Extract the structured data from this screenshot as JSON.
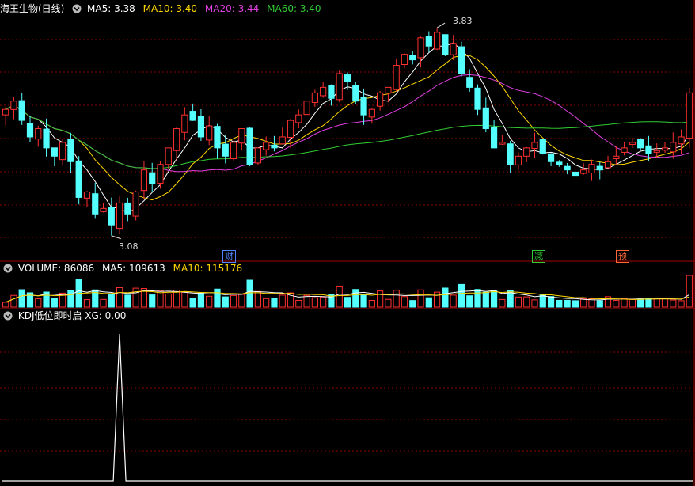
{
  "main_panel": {
    "title": "海王生物(日线)",
    "ma_items": [
      {
        "label": "MA5: 3.38",
        "color": "#ffffff"
      },
      {
        "label": "MA10: 3.40",
        "color": "#ffd700"
      },
      {
        "label": "MA20: 3.44",
        "color": "#e040e0"
      },
      {
        "label": "MA60: 3.40",
        "color": "#33cc33"
      }
    ],
    "high_label": "3.83",
    "low_label": "3.08",
    "event_tags": [
      {
        "text": "财",
        "color": "#4f86ff"
      },
      {
        "text": "减",
        "color": "#33cc33"
      },
      {
        "text": "预",
        "color": "#ff6633"
      }
    ]
  },
  "volume_panel": {
    "label": "VOLUME: 86086",
    "ma5_label": "MA5: 109613",
    "ma10_label": "MA10: 115176"
  },
  "indicator_panel": {
    "label": "KDJ低位即时启 XG: 0.00"
  },
  "colors": {
    "up": "#ff3030",
    "down": "#54ffff",
    "grid": "#8b0000",
    "ma5": "#ffffff",
    "ma10": "#ffd700",
    "ma20": "#e040e0",
    "ma60": "#33cc33"
  },
  "chart_data": {
    "type": "candlestick",
    "price_range": [
      3.08,
      3.83
    ],
    "closes": [
      3.52,
      3.55,
      3.48,
      3.42,
      3.45,
      3.38,
      3.35,
      3.4,
      3.33,
      3.2,
      3.22,
      3.14,
      3.16,
      3.1,
      3.18,
      3.14,
      3.22,
      3.3,
      3.25,
      3.32,
      3.38,
      3.45,
      3.5,
      3.48,
      3.42,
      3.46,
      3.38,
      3.35,
      3.4,
      3.45,
      3.32,
      3.38,
      3.4,
      3.38,
      3.42,
      3.48,
      3.5,
      3.55,
      3.58,
      3.6,
      3.56,
      3.65,
      3.62,
      3.55,
      3.5,
      3.52,
      3.58,
      3.6,
      3.68,
      3.72,
      3.7,
      3.78,
      3.75,
      3.8,
      3.72,
      3.76,
      3.65,
      3.6,
      3.52,
      3.45,
      3.38,
      3.4,
      3.32,
      3.35,
      3.38,
      3.4,
      3.36,
      3.33,
      3.32,
      3.3,
      3.28,
      3.3,
      3.32,
      3.3,
      3.33,
      3.35,
      3.38,
      3.4,
      3.38,
      3.36,
      3.37,
      3.38,
      3.4,
      3.42,
      3.58
    ],
    "xg_signal_index": 14
  }
}
